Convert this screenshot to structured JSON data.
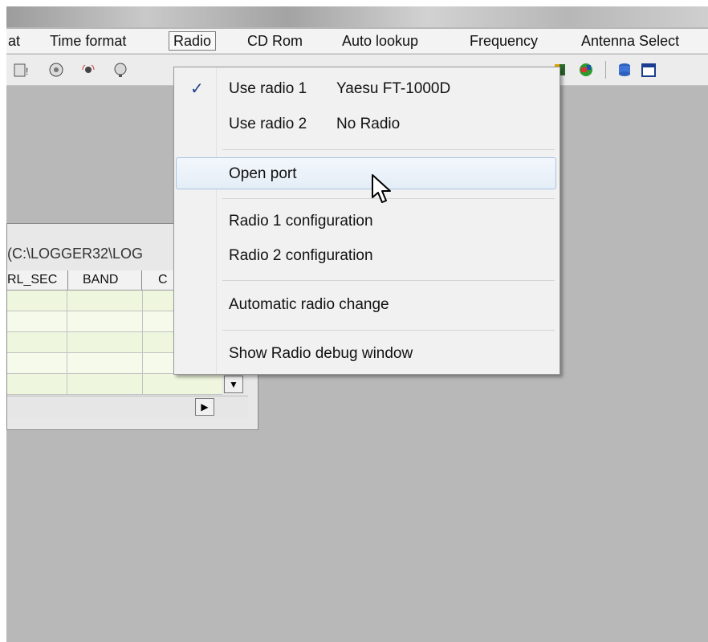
{
  "menubar": {
    "items": [
      {
        "label": "at"
      },
      {
        "label": "Time format"
      },
      {
        "label": "Radio"
      },
      {
        "label": "CD Rom"
      },
      {
        "label": "Auto lookup"
      },
      {
        "label": "Frequency"
      },
      {
        "label": "Antenna Select"
      }
    ]
  },
  "logwindow": {
    "title": "(C:\\LOGGER32\\LOG",
    "columns": [
      "RL_SEC",
      "BAND",
      "C"
    ],
    "rows": 5
  },
  "radio_menu": {
    "use_radio_1": {
      "label": "Use radio 1",
      "value": "Yaesu FT-1000D",
      "checked": true
    },
    "use_radio_2": {
      "label": "Use radio 2",
      "value": "No Radio"
    },
    "open_port": "Open port",
    "radio_1_config": "Radio 1 configuration",
    "radio_2_config": "Radio 2 configuration",
    "auto_change": "Automatic radio change",
    "debug_window": "Show Radio debug window",
    "check_glyph": "✓"
  },
  "colors": {
    "menu_highlight": "#e4edf7",
    "check": "#1c3f8c",
    "desktop": "#b8b8b8"
  }
}
